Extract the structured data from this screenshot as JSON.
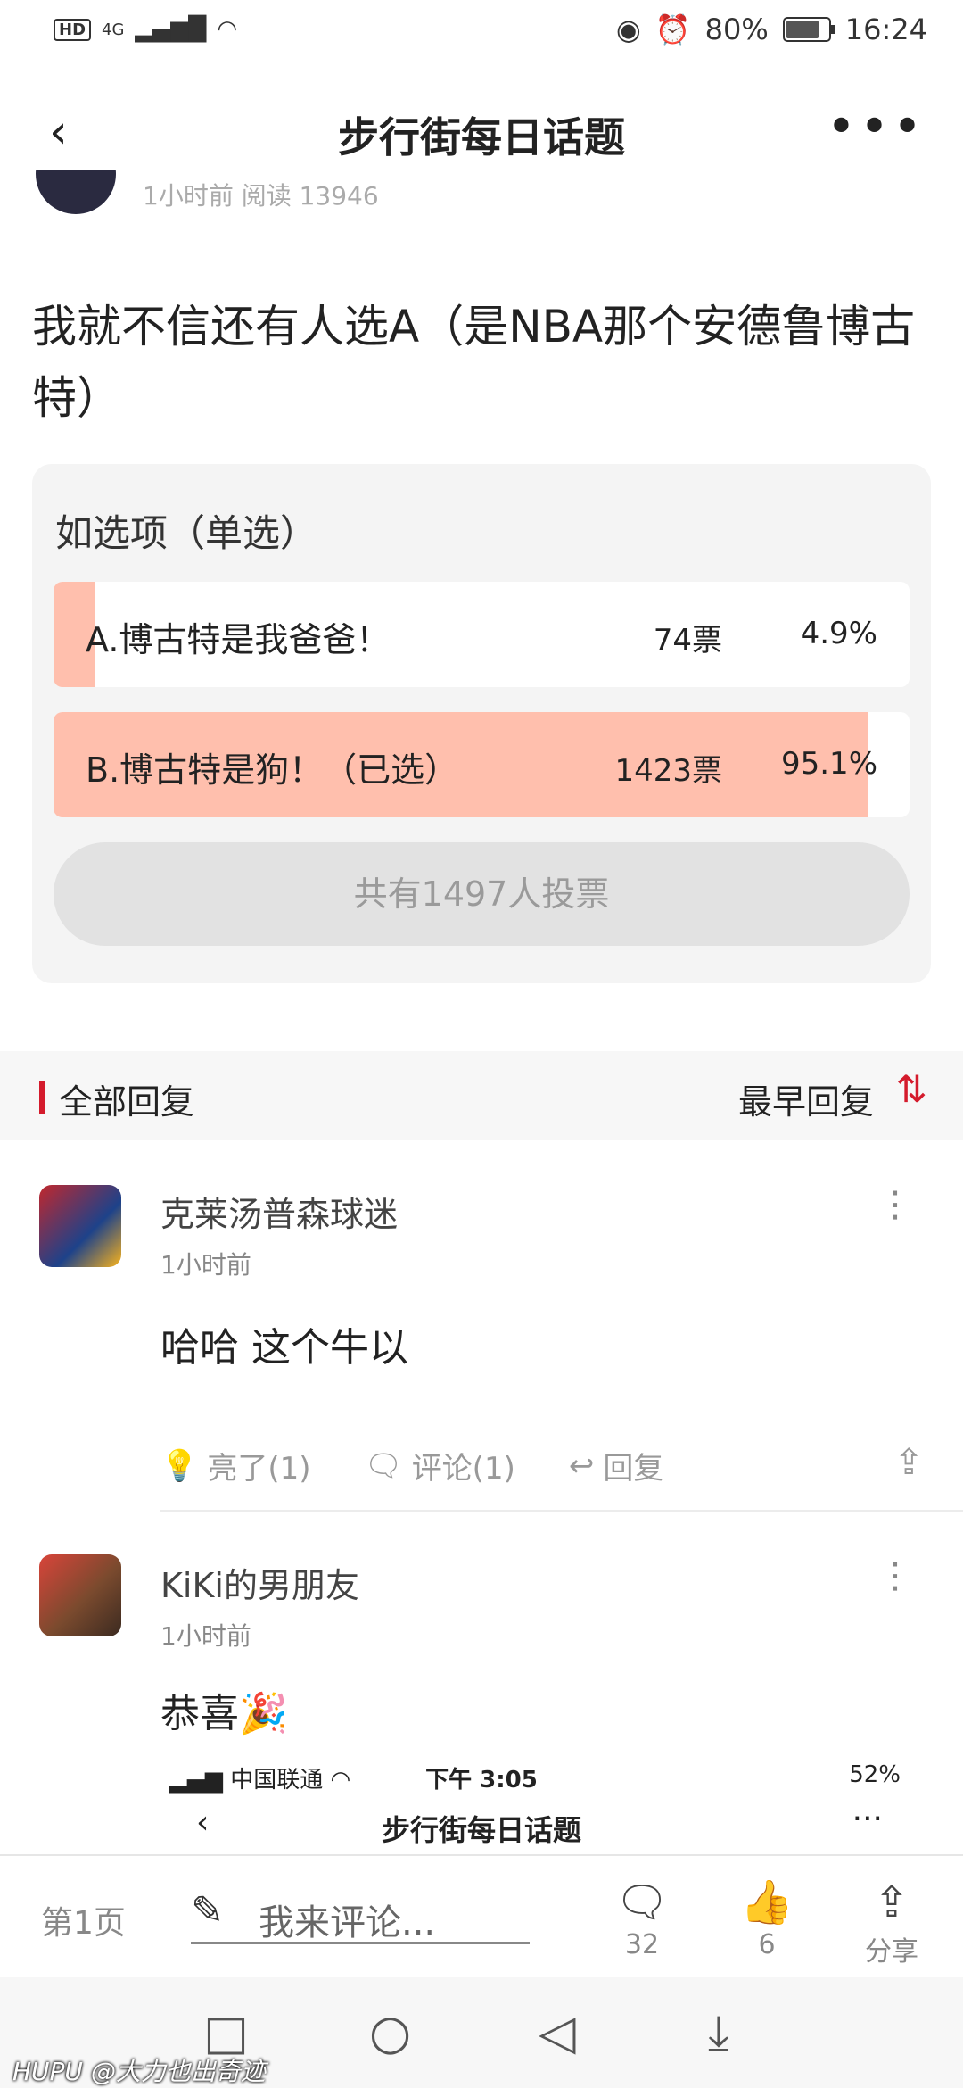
{
  "status_bar": {
    "hd": "HD",
    "network": "4G",
    "battery": "80%",
    "time": "16:24"
  },
  "nav": {
    "title": "步行街每日话题"
  },
  "post_meta": {
    "text": "1小时前   阅读 13946"
  },
  "question": "我就不信还有人选A（是NBA那个安德鲁博古特）",
  "poll": {
    "label": "如选项（单选）",
    "options": [
      {
        "text": "A.博古特是我爸爸！",
        "votes": "74票",
        "percent": "4.9%",
        "fraction": 0.049
      },
      {
        "text": "B.博古特是狗！（已选）",
        "votes": "1423票",
        "percent": "95.1%",
        "fraction": 0.951
      }
    ],
    "total": "共有1497人投票"
  },
  "replies_header": {
    "label": "全部回复",
    "sort": "最早回复"
  },
  "comments": [
    {
      "name": "克莱汤普森球迷",
      "time": "1小时前",
      "body": "哈哈 这个牛以",
      "actions": {
        "light": "亮了(1)",
        "comment": "评论(1)",
        "reply": "回复"
      }
    },
    {
      "name": "KiKi的男朋友",
      "time": "1小时前",
      "body": "恭喜🎉"
    }
  ],
  "embedded_screenshot": {
    "carrier": "中国联通",
    "time": "下午 3:05",
    "battery": "52%",
    "title": "步行街每日话题"
  },
  "bottom_bar": {
    "page": "第1页",
    "comment_placeholder": "我来评论...",
    "comments_count": "32",
    "likes_count": "6",
    "share_label": "分享"
  },
  "watermark": "HUPU @大力也出奇迹"
}
